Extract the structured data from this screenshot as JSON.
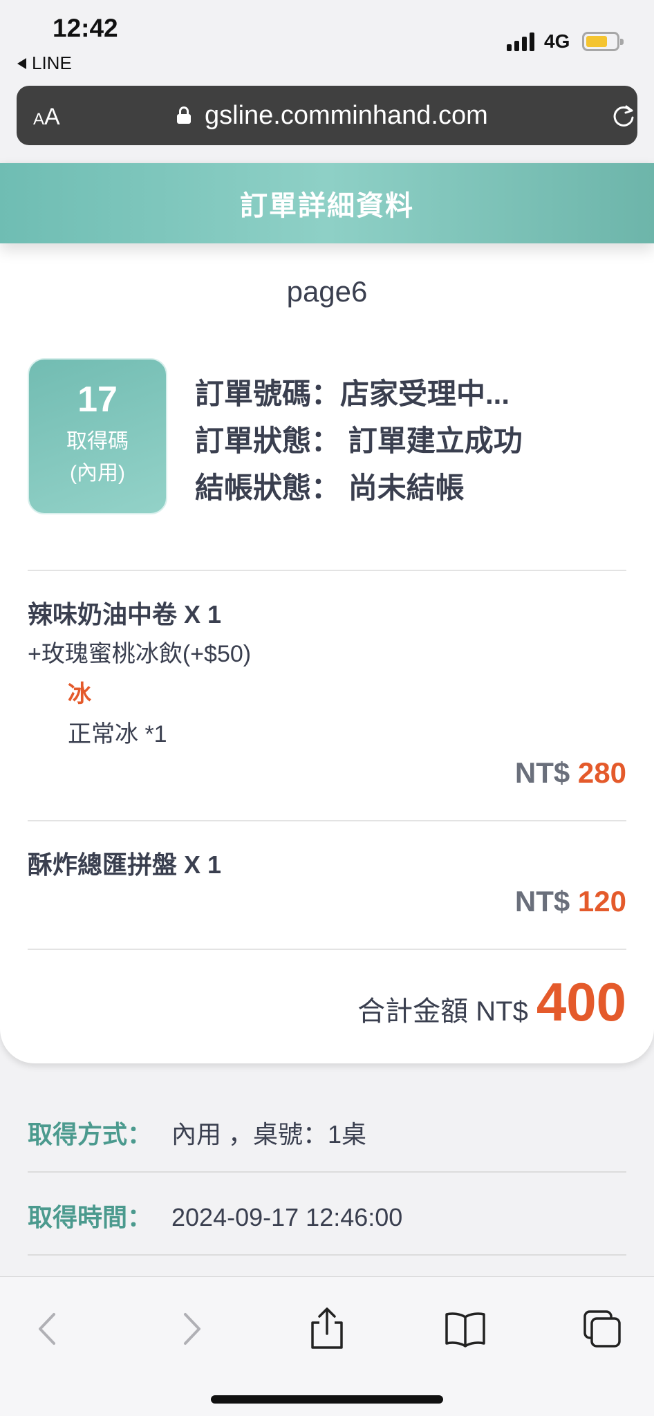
{
  "status_bar": {
    "time": "12:42",
    "back_app": "LINE",
    "network": "4G",
    "battery_color": "#f4c430"
  },
  "browser": {
    "text_size_label_small": "A",
    "text_size_label_large": "A",
    "url": "gsline.comminhand.com",
    "lock_icon": "lock-icon",
    "reload_icon": "reload-icon"
  },
  "header": {
    "title": "訂單詳細資料"
  },
  "page_label": "page6",
  "pickup": {
    "number": "17",
    "label_line1": "取得碼",
    "label_line2": "(內用)"
  },
  "order": {
    "number_label": "訂單號碼：",
    "number_value": "店家受理中...",
    "status_label": "訂單狀態：",
    "status_value": "訂單建立成功",
    "payment_label": "結帳狀態：",
    "payment_value": "尚未結帳"
  },
  "items": [
    {
      "name": "辣味奶油中卷 X 1",
      "addon": "+玫瑰蜜桃冰飲(+$50)",
      "option_group": "冰",
      "option_value": "正常冰 *1",
      "currency": "NT$",
      "price": "280"
    },
    {
      "name": "酥炸總匯拼盤 X 1",
      "currency": "NT$",
      "price": "120"
    }
  ],
  "total": {
    "label": "合計金額 NT$",
    "amount": "400"
  },
  "info": {
    "method_label": "取得方式：",
    "method_value": "內用 ，桌號：1桌",
    "time_label": "取得時間：",
    "time_value": "2024-09-17 12:46:00"
  },
  "colors": {
    "accent_teal": "#7cc5bb",
    "price_orange": "#e45a2b",
    "label_teal": "#4b9a8e"
  }
}
